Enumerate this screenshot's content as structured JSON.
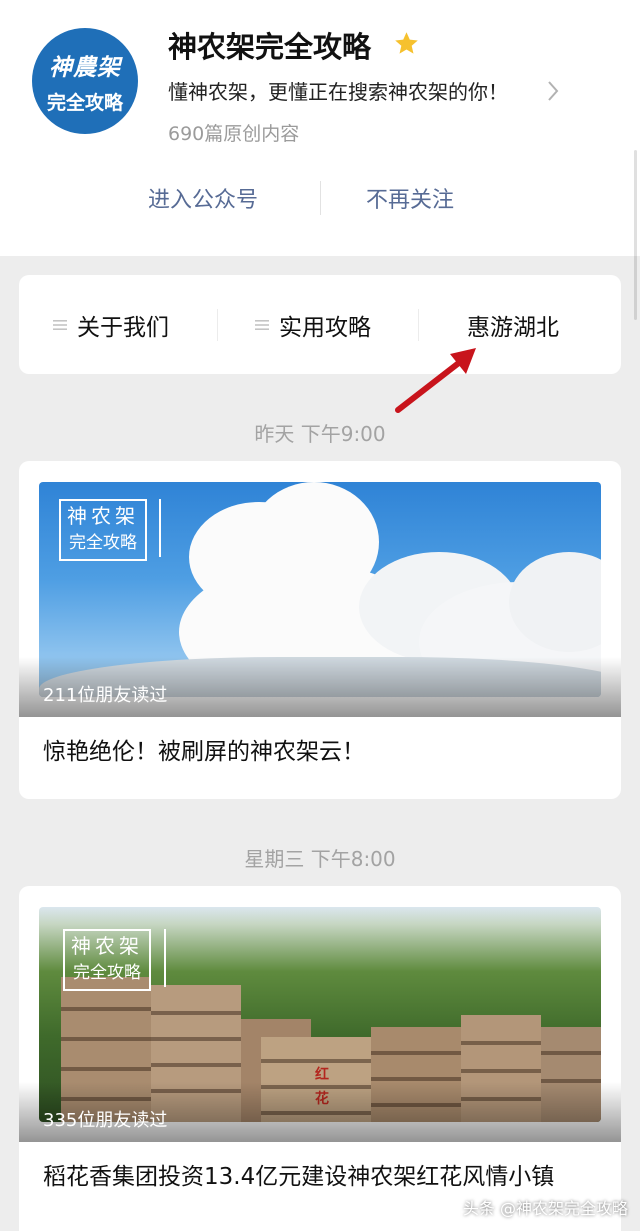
{
  "account": {
    "avatar_text_top": "神農架",
    "avatar_text_bottom": "完全攻略",
    "name": "神农架完全攻略",
    "description": "懂神农架，更懂正在搜索神农架的你！",
    "article_count": "690篇原创内容",
    "enter_label": "进入公众号",
    "unfollow_label": "不再关注",
    "star_color": "#f6c12e",
    "link_color": "#576b95"
  },
  "menu": {
    "items": [
      {
        "label": "关于我们",
        "icon": "menu-list-icon"
      },
      {
        "label": "实用攻略",
        "icon": "menu-list-icon"
      },
      {
        "label": "惠游湖北"
      }
    ],
    "annotation_arrow_color": "#c8141c"
  },
  "feed": [
    {
      "timestamp": "昨天 下午9:00",
      "cover_watermark_top": "神农架",
      "cover_watermark_bottom": "完全攻略",
      "read_count": "211位朋友读过",
      "title": "惊艳绝伦！被刷屏的神农架云！"
    },
    {
      "timestamp": "星期三 下午8:00",
      "cover_watermark_top": "神农架",
      "cover_watermark_bottom": "完全攻略",
      "cover_sign": "红花",
      "read_count": "335位朋友读过",
      "title": "稻花香集团投资13.4亿元建设神农架红花风情小镇"
    }
  ],
  "source_tag": "头条 @神农架完全攻略"
}
